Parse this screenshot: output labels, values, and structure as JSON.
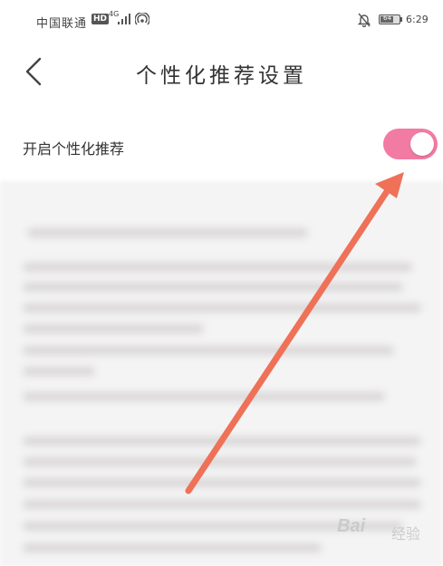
{
  "status_bar": {
    "carrier": "中国联通",
    "hd": "HD",
    "network": "4G",
    "battery": "64",
    "time": "6:29"
  },
  "header": {
    "title": "个性化推荐设置"
  },
  "setting": {
    "label": "开启个性化推荐",
    "enabled": true,
    "toggle_color": "#f27ba3"
  },
  "annotation": {
    "arrow_color": "#ee7158"
  },
  "watermark": {
    "brand": "Bai",
    "suffix": "经验"
  }
}
